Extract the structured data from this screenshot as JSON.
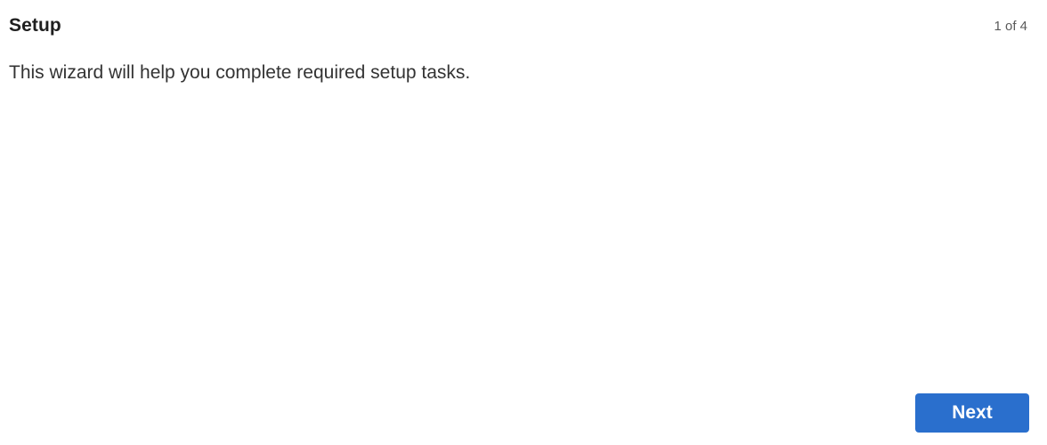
{
  "wizard": {
    "title": "Setup",
    "step_counter": "1 of 4",
    "description": "This wizard will help you complete required setup tasks.",
    "next_label": "Next"
  },
  "colors": {
    "accent": "#2a6fcd",
    "title_text": "#1f1f1f",
    "body_text": "#333333",
    "muted_text": "#5a5a5a",
    "background": "#ffffff"
  }
}
